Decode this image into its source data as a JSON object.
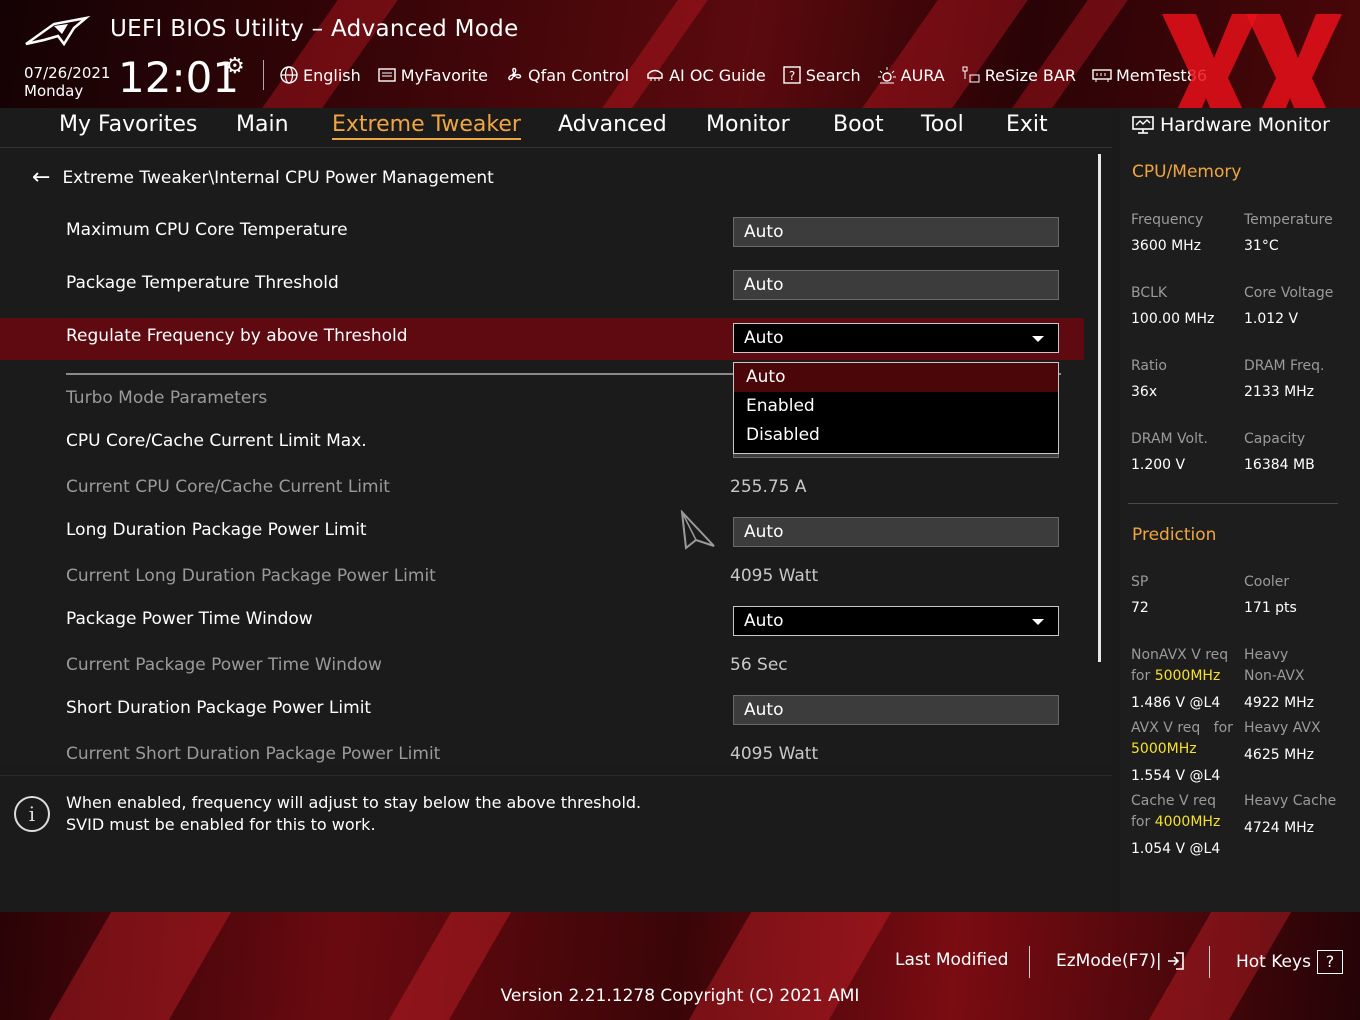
{
  "header": {
    "title": "UEFI BIOS Utility – Advanced Mode",
    "date": "07/26/2021",
    "day": "Monday",
    "time": "12:01",
    "toolbar": [
      {
        "label": "English",
        "icon": "globe-icon"
      },
      {
        "label": "MyFavorite",
        "icon": "favorite-icon"
      },
      {
        "label": "Qfan Control",
        "icon": "fan-icon"
      },
      {
        "label": "AI OC Guide",
        "icon": "chip-icon"
      },
      {
        "label": "Search",
        "icon": "search-icon"
      },
      {
        "label": "AURA",
        "icon": "aura-icon"
      },
      {
        "label": "ReSize BAR",
        "icon": "resize-bar-icon"
      },
      {
        "label": "MemTest86",
        "icon": "memory-icon"
      }
    ]
  },
  "tabs": [
    {
      "label": "My Favorites"
    },
    {
      "label": "Main"
    },
    {
      "label": "Extreme Tweaker",
      "active": true
    },
    {
      "label": "Advanced"
    },
    {
      "label": "Monitor"
    },
    {
      "label": "Boot"
    },
    {
      "label": "Tool"
    },
    {
      "label": "Exit"
    }
  ],
  "main": {
    "breadcrumb": "Extreme Tweaker\\Internal CPU Power Management",
    "rows": {
      "max_cpu_core_temp": {
        "label": "Maximum CPU Core Temperature",
        "value": "Auto"
      },
      "package_temp_threshold": {
        "label": "Package Temperature Threshold",
        "value": "Auto"
      },
      "regulate_frequency": {
        "label": "Regulate Frequency by above Threshold",
        "value": "Auto"
      },
      "turbo_mode_parameters": {
        "label": "Turbo Mode Parameters"
      },
      "cpu_core_cache_limit_max": {
        "label": "CPU Core/Cache Current Limit Max."
      },
      "current_cpu_core_cache_limit": {
        "label": "Current CPU Core/Cache Current Limit",
        "value": "255.75 A"
      },
      "long_duration_power_limit": {
        "label": "Long Duration Package Power Limit",
        "value": "Auto"
      },
      "current_long_duration_power_limit": {
        "label": "Current Long Duration Package Power Limit",
        "value": "4095 Watt"
      },
      "package_power_time_window": {
        "label": "Package Power Time Window",
        "value": "Auto"
      },
      "current_package_power_time_window": {
        "label": "Current Package Power Time Window",
        "value": "56 Sec"
      },
      "short_duration_power_limit": {
        "label": "Short Duration Package Power Limit",
        "value": "Auto"
      },
      "current_short_duration_power_limit": {
        "label": "Current Short Duration Package Power Limit",
        "value": "4095 Watt"
      }
    },
    "dropdown_options": [
      "Auto",
      "Enabled",
      "Disabled"
    ],
    "dropdown_selected": "Auto"
  },
  "info": {
    "line1": "When enabled, frequency will adjust to stay below the above threshold.",
    "line2": "SVID must be enabled for this to work."
  },
  "hw_monitor": {
    "title": "Hardware Monitor",
    "cpu_memory_title": "CPU/Memory",
    "frequency_label": "Frequency",
    "frequency_value": "3600 MHz",
    "temperature_label": "Temperature",
    "temperature_value": "31°C",
    "bclk_label": "BCLK",
    "bclk_value": "100.00 MHz",
    "core_voltage_label": "Core Voltage",
    "core_voltage_value": "1.012 V",
    "ratio_label": "Ratio",
    "ratio_value": "36x",
    "dram_freq_label": "DRAM Freq.",
    "dram_freq_value": "2133 MHz",
    "dram_volt_label": "DRAM Volt.",
    "dram_volt_value": "1.200 V",
    "capacity_label": "Capacity",
    "capacity_value": "16384 MB",
    "prediction_title": "Prediction",
    "sp_label": "SP",
    "sp_value": "72",
    "cooler_label": "Cooler",
    "cooler_value": "171 pts",
    "nonavx_label_1": "NonAVX V req",
    "nonavx_label_2": "for",
    "nonavx_freq": "5000MHz",
    "nonavx_value": "1.486 V @L4",
    "heavy_nonavx_label_1": "Heavy",
    "heavy_nonavx_label_2": "Non-AVX",
    "heavy_nonavx_value": "4922 MHz",
    "avx_label_1": "AVX V req",
    "avx_label_2": "for",
    "avx_freq": "5000MHz",
    "avx_value": "1.554 V @L4",
    "heavy_avx_label": "Heavy AVX",
    "heavy_avx_value": "4625 MHz",
    "cache_label_1": "Cache V req",
    "cache_label_2": "for",
    "cache_freq": "4000MHz",
    "cache_value": "1.054 V @L4",
    "heavy_cache_label": "Heavy Cache",
    "heavy_cache_value": "4724 MHz"
  },
  "footer": {
    "last_modified": "Last Modified",
    "ezmode": "EzMode(F7)|",
    "hot_keys": "Hot Keys",
    "hot_keys_key": "?",
    "version": "Version 2.21.1278 Copyright (C) 2021 AMI"
  },
  "colors": {
    "accent": "#f0a640",
    "highlight_row": "#5e0a10",
    "prediction_highlight": "#f5e02a"
  }
}
